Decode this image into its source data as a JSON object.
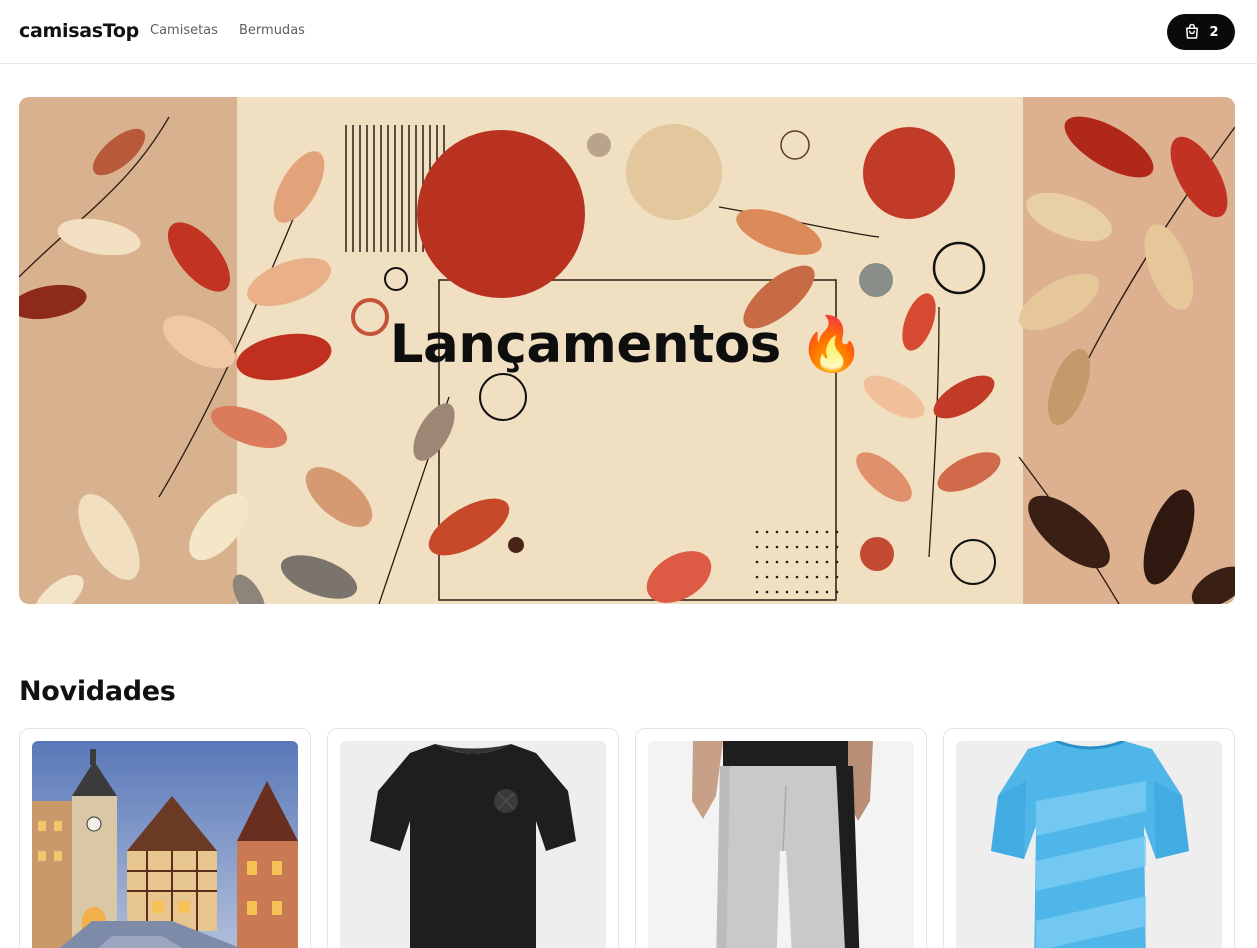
{
  "header": {
    "logo": "camisasTop",
    "nav": [
      "Camisetas",
      "Bermudas"
    ],
    "cart_count": "2",
    "cart_icon": "shopping-bag-icon"
  },
  "hero": {
    "title": "Lançamentos 🔥"
  },
  "section": {
    "title": "Novidades"
  },
  "products": [
    {
      "image": "town-street-photo"
    },
    {
      "image": "black-tshirt-photo"
    },
    {
      "image": "grey-track-pants-photo"
    },
    {
      "image": "light-blue-jersey-photo"
    }
  ],
  "colors": {
    "accent": "#0a0a0a",
    "hero_bg": "#efdcbd",
    "leaf_red": "#c0392b"
  }
}
